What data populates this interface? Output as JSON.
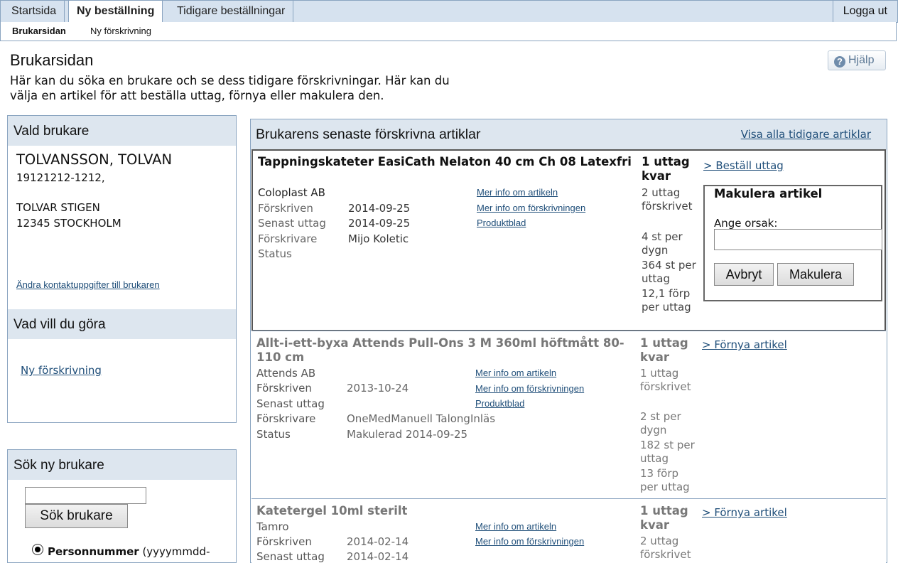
{
  "topnav": {
    "tabs": [
      "Startsida",
      "Ny beställning",
      "Tidigare beställningar"
    ],
    "logout": "Logga ut"
  },
  "subnav": {
    "items": [
      "Brukarsidan",
      "Ny förskrivning"
    ]
  },
  "page": {
    "title": "Brukarsidan",
    "description": "Här kan du söka en brukare och se dess tidigare förskrivningar. Här kan du välja en artikel för att beställa uttag, förnya eller makulera den.",
    "help": "Hjälp"
  },
  "user_panel": {
    "title": "Vald brukare",
    "name": "TOLVANSSON, TOLVAN",
    "pnr": "19121212-1212,",
    "address1": "TOLVAR STIGEN",
    "address2": "12345 STOCKHOLM",
    "edit_link": "Ändra kontaktuppgifter till brukaren",
    "actions_title": "Vad vill du göra",
    "new_prescription": "Ny förskrivning"
  },
  "search_panel": {
    "title": "Sök ny brukare",
    "input_value": "",
    "button": "Sök brukare",
    "radio_bold": "Personnummer",
    "radio_rest": " (yyyymmdd-"
  },
  "articles_panel": {
    "title": "Brukarens senaste förskrivna artiklar",
    "show_all": "Visa alla tidigare artiklar",
    "labels": {
      "prescribed": "Förskriven",
      "last": "Senast uttag",
      "prescriber": "Förskrivare",
      "status": "Status",
      "info_article": "Mer info om artikeln",
      "info_prescription": "Mer info om förskrivningen",
      "product_sheet": "Produktblad"
    },
    "items": [
      {
        "title": "Tappningskateter EasiCath Nelaton 40 cm Ch 08 Latexfri",
        "supplier": "Coloplast AB",
        "prescribed": "2014-09-25",
        "last": "2014-09-25",
        "prescriber": "Mijo Koletic",
        "status": "",
        "remaining": "1 uttag kvar",
        "prescribed_count": "2 uttag förskrivet",
        "dose1": "4 st per dygn",
        "dose2": "364 st per uttag",
        "dose3": "12,1 förp per uttag",
        "action": "> Beställ uttag"
      },
      {
        "title": "Allt-i-ett-byxa Attends Pull-Ons 3 M 360ml höftmått 80-110 cm",
        "supplier": "Attends AB",
        "prescribed": "2013-10-24",
        "last": "",
        "prescriber": "OneMedManuell TalongInläs",
        "status": "Makulerad 2014-09-25",
        "remaining": "1 uttag kvar",
        "prescribed_count": "1 uttag förskrivet",
        "dose1": "2 st per dygn",
        "dose2": "182 st per uttag",
        "dose3": "13 förp per uttag",
        "action": "> Förnya artikel"
      },
      {
        "title": "Katetergel 10ml sterilt",
        "supplier": "Tamro",
        "prescribed": "2014-02-14",
        "last": "2014-02-14",
        "remaining": "1 uttag kvar",
        "prescribed_count": "2 uttag förskrivet",
        "action": "> Förnya artikel"
      }
    ]
  },
  "cancel_box": {
    "title": "Makulera artikel",
    "reason_label": "Ange orsak:",
    "reason_value": "",
    "cancel_button": "Avbryt",
    "confirm_button": "Makulera"
  }
}
